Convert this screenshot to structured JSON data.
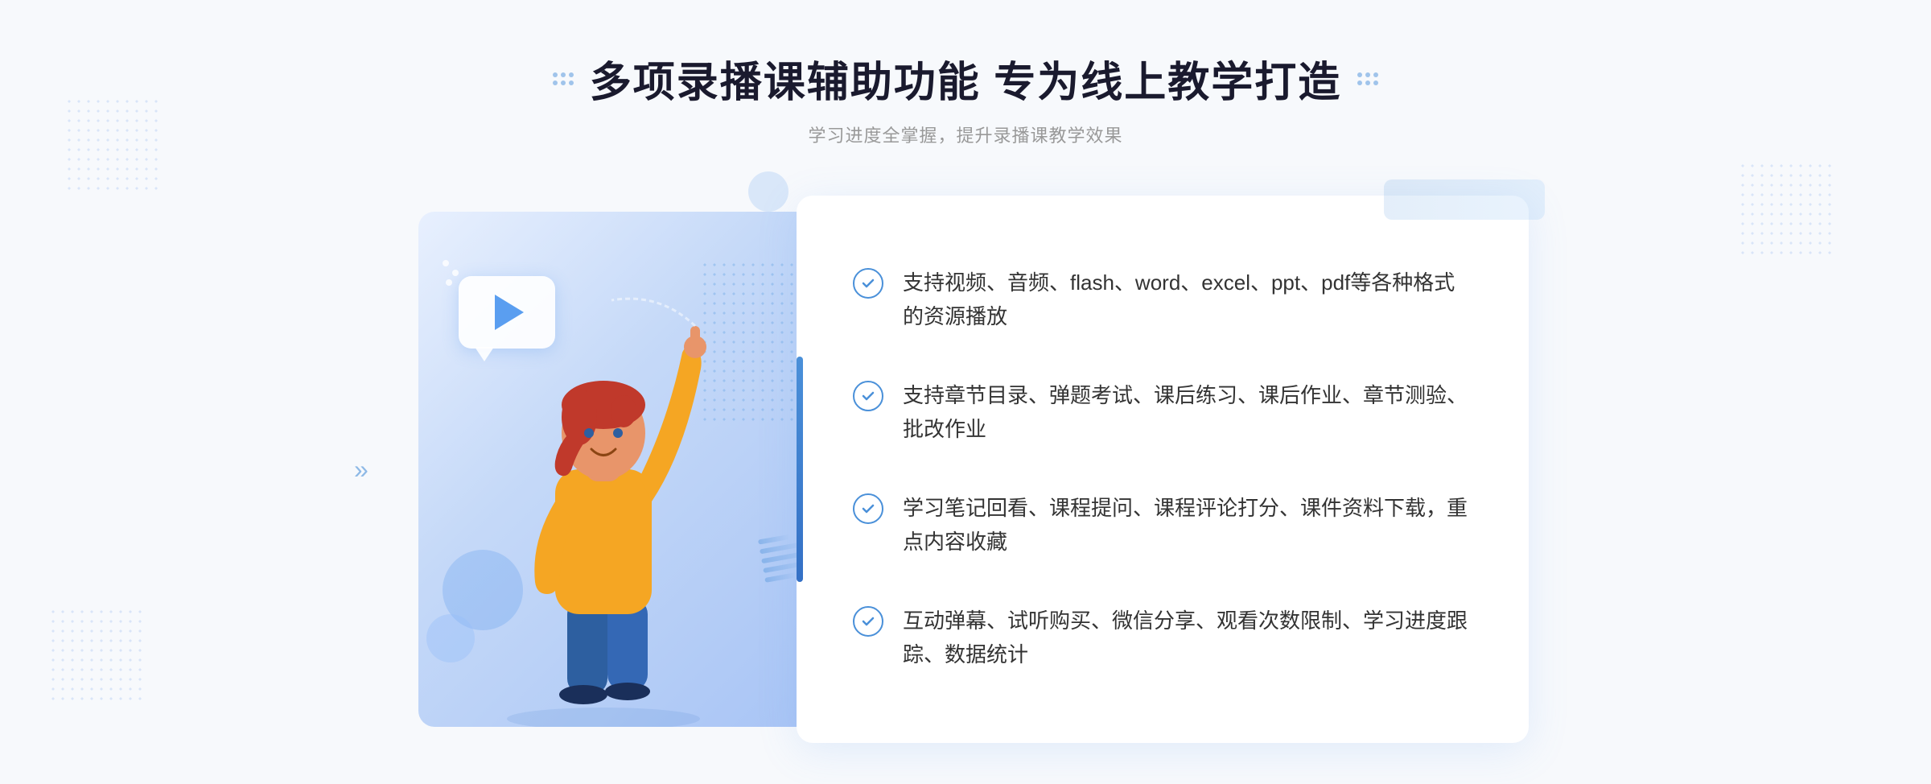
{
  "header": {
    "title": "多项录播课辅助功能 专为线上教学打造",
    "subtitle": "学习进度全掌握，提升录播课教学效果",
    "dots_decoration": "decoration"
  },
  "features": [
    {
      "id": 1,
      "text": "支持视频、音频、flash、word、excel、ppt、pdf等各种格式的资源播放"
    },
    {
      "id": 2,
      "text": "支持章节目录、弹题考试、课后练习、课后作业、章节测验、批改作业"
    },
    {
      "id": 3,
      "text": "学习笔记回看、课程提问、课程评论打分、课件资料下载，重点内容收藏"
    },
    {
      "id": 4,
      "text": "互动弹幕、试听购买、微信分享、观看次数限制、学习进度跟踪、数据统计"
    }
  ],
  "left_chevrons": "»",
  "colors": {
    "primary": "#4a90d9",
    "text_dark": "#1a1a2e",
    "text_light": "#999999",
    "text_body": "#333333",
    "bg_page": "#f7f9fc",
    "bg_white": "#ffffff"
  }
}
